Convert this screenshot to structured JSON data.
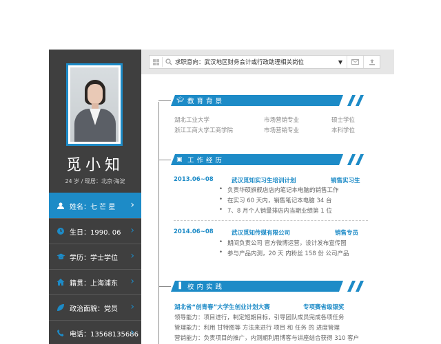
{
  "topbar": {
    "search_text": "求职意向：武汉地区财务会计或行政助理相关岗位",
    "icons": [
      "windows-icon",
      "search-icon",
      "dropdown-arrow-icon",
      "mail-icon",
      "upload-icon"
    ]
  },
  "profile": {
    "name": "觅小知",
    "meta": "24 岁 / 现居：北京·海淀"
  },
  "info": [
    {
      "label": "姓名：七 芒 星",
      "icon": "user-icon"
    },
    {
      "label": "生日：1990. 06",
      "icon": "clock-icon"
    },
    {
      "label": "学历：学士学位",
      "icon": "graduation-icon"
    },
    {
      "label": "籍贯：上海浦东",
      "icon": "home-icon"
    },
    {
      "label": "政治面貌：党员",
      "icon": "leaf-icon"
    },
    {
      "label": "电话：13568135686",
      "icon": "phone-icon"
    }
  ],
  "sections": {
    "education": {
      "title": "教育背景",
      "rows": [
        {
          "school": "湖北工业大学",
          "major": "市场营销专业",
          "degree": "硕士学位"
        },
        {
          "school": "浙江工商大学工商学院",
          "major": "市场营销专业",
          "degree": "本科学位"
        }
      ]
    },
    "work": {
      "title": "工作经历",
      "jobs": [
        {
          "date": "2013.06~08",
          "company": "武汉觅知实习生培训计划",
          "role": "销售实习生",
          "bullets": [
            "负责华硕旗舰店店内笔记本电脑的销售工作",
            "在实习 60 天内，销售笔记本电脑 34 台",
            "7、8 月个人销量排店内当期业绩第 1 位"
          ]
        },
        {
          "date": "2014.06~08",
          "company": "武汉觅知传媒有限公司",
          "role": "销售专员",
          "bullets": [
            "期间负责公司 官方微博运营，设计发布宣传图",
            "参与产品内测，20 天 内粉丝 158 份 公司产品"
          ]
        }
      ]
    },
    "campus": {
      "title": "校内实践",
      "event": "湖北省“创青春”大学生创业计划大赛",
      "award": "专项赛省级银奖",
      "lines": [
        "领导能力：项目进行，制定短期目标，引导团队成员完成各项任务",
        "管理能力：利用  甘特图等  方法来进行  项目  和  任务  的  进度管理",
        "营销能力：负责项目的推广，内测期利用博客与讲座结合获得 310 客户"
      ]
    }
  },
  "colors": {
    "accent": "#1d8bc7",
    "sidebar": "#3f3f3f",
    "muted": "#8a8a8a"
  }
}
